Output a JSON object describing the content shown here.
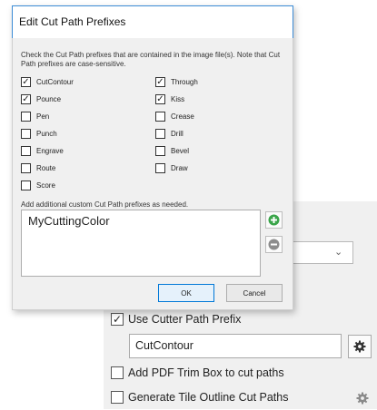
{
  "dialog": {
    "title": "Edit Cut Path Prefixes",
    "description": "Check the Cut Path prefixes that are contained in the image file(s). Note that Cut Path prefixes are case-sensitive.",
    "prefixes": [
      {
        "label": "CutContour",
        "checked": true
      },
      {
        "label": "Through",
        "checked": true
      },
      {
        "label": "Pounce",
        "checked": true
      },
      {
        "label": "Kiss",
        "checked": true
      },
      {
        "label": "Pen",
        "checked": false
      },
      {
        "label": "Crease",
        "checked": false
      },
      {
        "label": "Punch",
        "checked": false
      },
      {
        "label": "Drill",
        "checked": false
      },
      {
        "label": "Engrave",
        "checked": false
      },
      {
        "label": "Bevel",
        "checked": false
      },
      {
        "label": "Route",
        "checked": false
      },
      {
        "label": "Draw",
        "checked": false
      },
      {
        "label": "Score",
        "checked": false
      }
    ],
    "custom_label": "Add additional custom Cut Path prefixes as needed.",
    "custom_prefixes": [
      "MyCuttingColor"
    ],
    "add_icon": "plus-circle-icon",
    "remove_icon": "minus-circle-icon",
    "ok_label": "OK",
    "cancel_label": "Cancel",
    "accent_color": "#0078d7",
    "add_color": "#3aa54a"
  },
  "settings": {
    "use_cutter_prefix": {
      "label": "Use Cutter Path Prefix",
      "checked": true
    },
    "prefix_value": "CutContour",
    "add_trim_box": {
      "label": "Add PDF Trim Box to cut paths",
      "checked": false
    },
    "tile_outline": {
      "label": "Generate Tile Outline Cut Paths",
      "checked": false
    },
    "gear_icon": "gear-icon"
  }
}
